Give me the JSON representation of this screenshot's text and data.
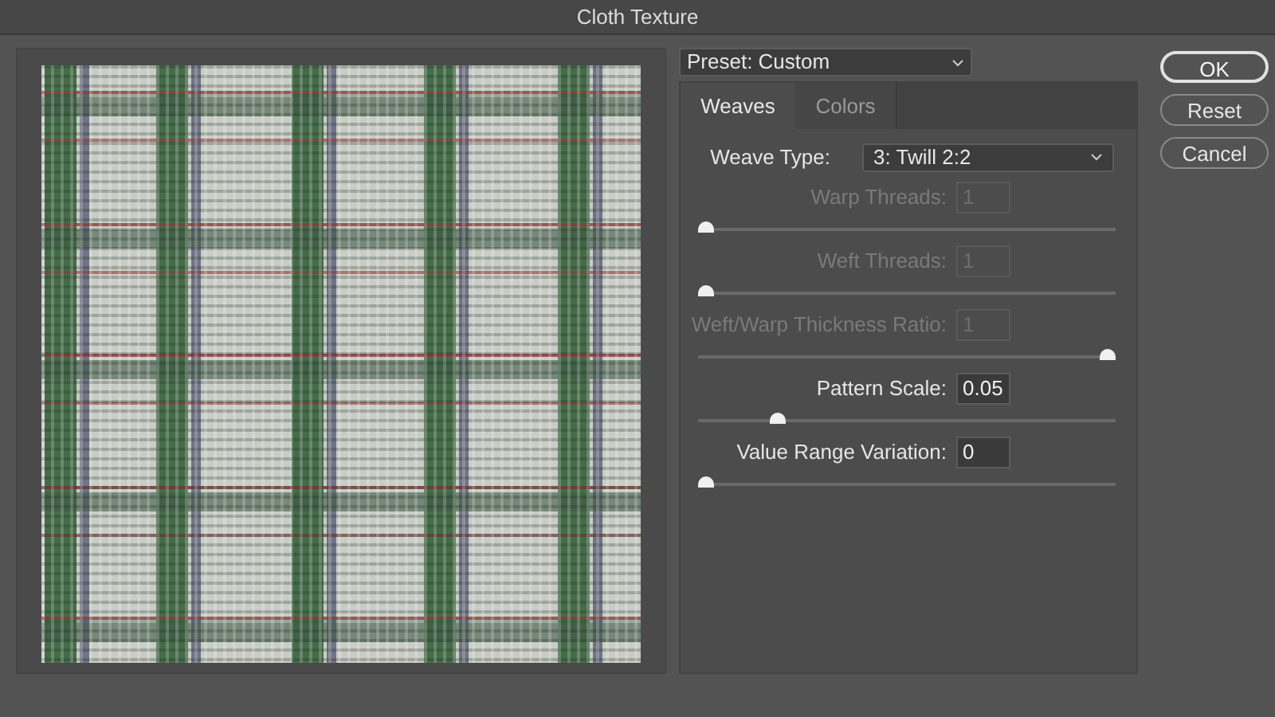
{
  "window": {
    "title": "Cloth Texture"
  },
  "preset": {
    "value": "Preset: Custom"
  },
  "tabs": [
    {
      "label": "Weaves",
      "selected": true
    },
    {
      "label": "Colors",
      "selected": false
    }
  ],
  "weave_type": {
    "label": "Weave Type:",
    "value": "3: Twill 2:2"
  },
  "sliders": [
    {
      "label": "Warp Threads:",
      "value": "1",
      "disabled": true,
      "level": 0
    },
    {
      "label": "Weft Threads:",
      "value": "1",
      "disabled": true,
      "level": 0
    },
    {
      "label": "Weft/Warp Thickness Ratio:",
      "value": "1",
      "disabled": true,
      "level": 1
    },
    {
      "label": "Pattern Scale:",
      "value": "0.05",
      "disabled": false,
      "level": 0.18
    },
    {
      "label": "Value Range Variation:",
      "value": "0",
      "disabled": false,
      "level": 0
    }
  ],
  "buttons": [
    {
      "label": "OK",
      "default": true
    },
    {
      "label": "Reset",
      "default": false
    },
    {
      "label": "Cancel",
      "default": false
    }
  ]
}
